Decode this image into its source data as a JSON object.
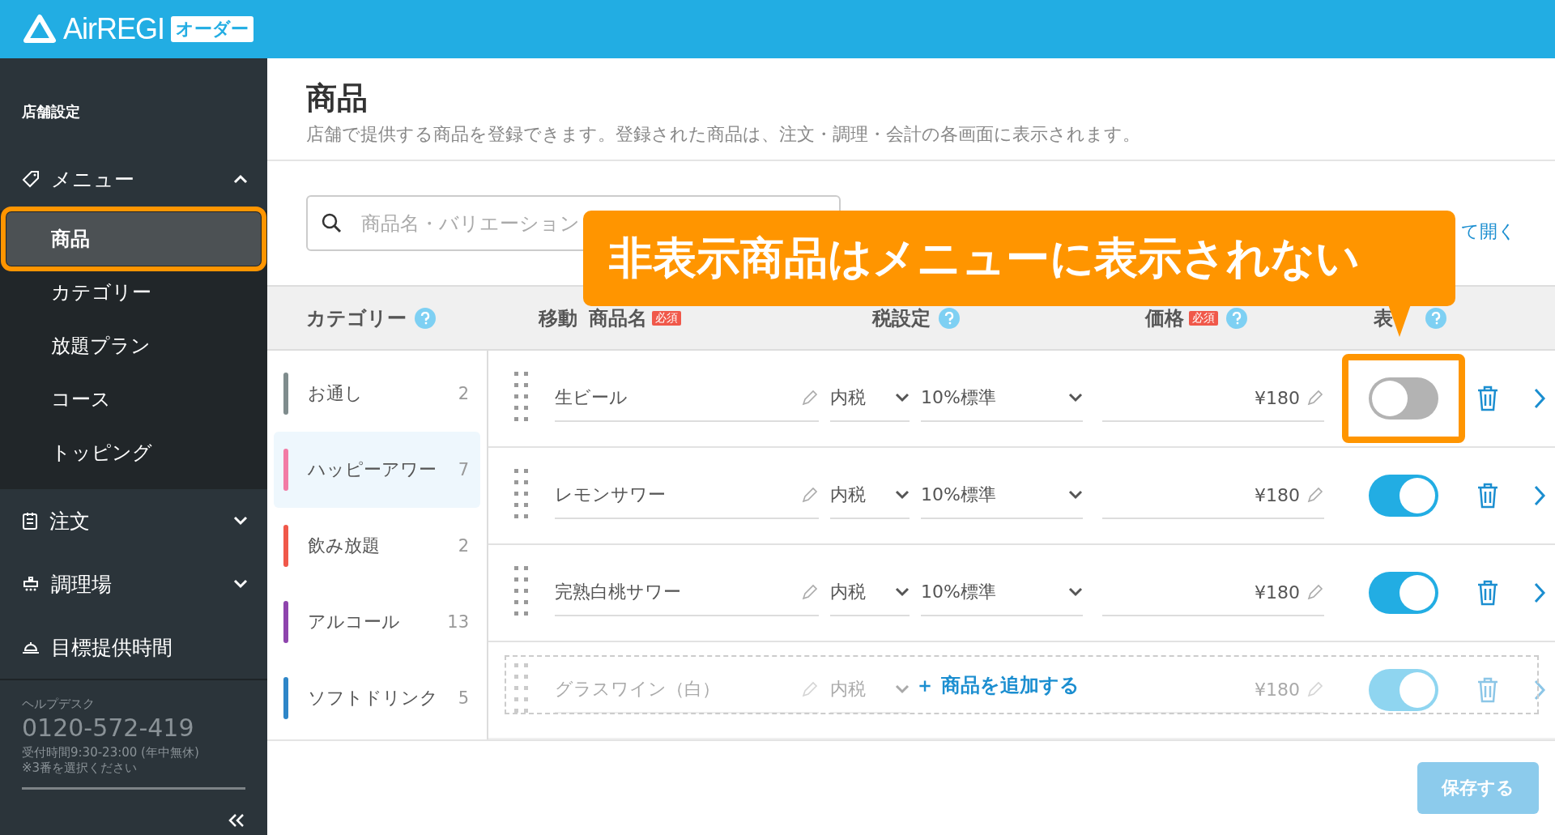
{
  "header": {
    "logo": "AirREGI",
    "badge": "オーダー"
  },
  "sidebar": {
    "section": "店舗設定",
    "groups": [
      {
        "label": "メニュー",
        "expanded": true,
        "children": [
          {
            "label": "商品",
            "selected": true,
            "highlighted": true
          },
          {
            "label": "カテゴリー",
            "selected": false,
            "highlighted": false
          },
          {
            "label": "放題プラン",
            "selected": false,
            "highlighted": false
          },
          {
            "label": "コース",
            "selected": false,
            "highlighted": false
          },
          {
            "label": "トッピング",
            "selected": false,
            "highlighted": false
          }
        ]
      },
      {
        "label": "注文",
        "expanded": false
      },
      {
        "label": "調理場",
        "expanded": false
      },
      {
        "label": "目標提供時間"
      }
    ],
    "help": {
      "title": "ヘルプデスク",
      "phone": "0120-572-419",
      "hours": "受付時間9:30-23:00 (年中無休)",
      "note": "※3番を選択ください"
    }
  },
  "page": {
    "title": "商品",
    "description": "店舗で提供する商品を登録できます。登録された商品は、注文・調理・会計の各画面に表示されます。"
  },
  "search": {
    "placeholder": "商品名・バリエーション"
  },
  "expand_link": "て開く",
  "columns": [
    {
      "label": "カテゴリー",
      "help": true
    },
    {
      "label": "移動",
      "help": false
    },
    {
      "label": "商品名",
      "badge": "必須",
      "help": false
    },
    {
      "label": "税設定",
      "help": true
    },
    {
      "label": "価格",
      "badge": "必須",
      "help": true
    },
    {
      "label": "表",
      "help": true
    }
  ],
  "categories": [
    {
      "name": "お通し",
      "count": "2",
      "color": "#7f8c8d",
      "selected": false
    },
    {
      "name": "ハッピーアワー",
      "count": "7",
      "color": "#f27ba5",
      "selected": true
    },
    {
      "name": "飲み放題",
      "count": "2",
      "color": "#f0584a",
      "selected": false
    },
    {
      "name": "アルコール",
      "count": "13",
      "color": "#8e44ad",
      "selected": false
    },
    {
      "name": "ソフトドリンク",
      "count": "5",
      "color": "#2e86c8",
      "selected": false
    }
  ],
  "products": [
    {
      "name": "生ビール",
      "tax": "内税",
      "rate": "10%標準",
      "price": "¥180",
      "on": false,
      "highlighted": true,
      "faded": false
    },
    {
      "name": "レモンサワー",
      "tax": "内税",
      "rate": "10%標準",
      "price": "¥180",
      "on": true,
      "highlighted": false,
      "faded": false
    },
    {
      "name": "完熟白桃サワー",
      "tax": "内税",
      "rate": "10%標準",
      "price": "¥180",
      "on": true,
      "highlighted": false,
      "faded": false
    },
    {
      "name": "グラスワイン（白）",
      "tax": "内税",
      "price": "¥180",
      "on": true,
      "highlighted": false,
      "faded": true
    }
  ],
  "add_button": "＋ 商品を追加する",
  "save_button": {
    "label": "保存する",
    "disabled": true
  },
  "callout": {
    "text": "非表示商品はメニューに表示されない"
  }
}
